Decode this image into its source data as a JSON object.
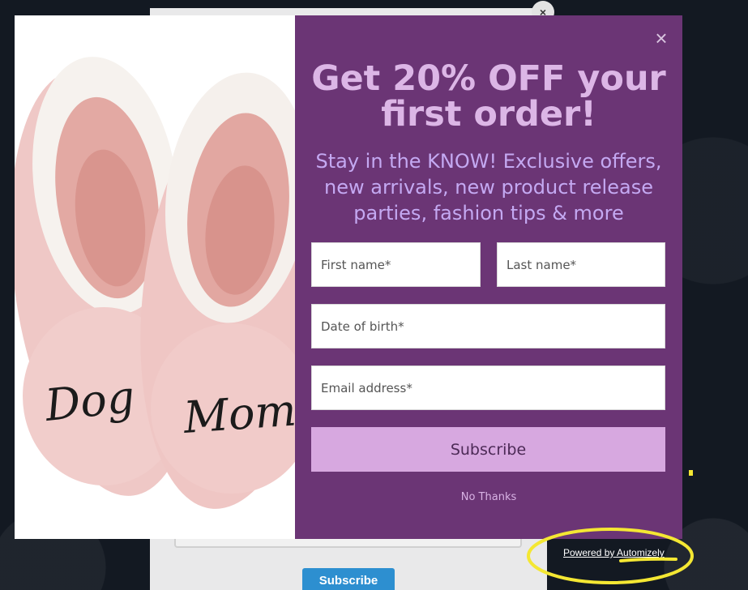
{
  "background": {
    "under_modal_close": "×",
    "under_modal_subscribe_label": "Subscribe"
  },
  "popup": {
    "image_text": {
      "left_slipper": "Dog",
      "right_slipper": "Mom"
    },
    "close_glyph": "×",
    "headline": "Get 20% OFF your first order!",
    "subheadline": "Stay in the KNOW! Exclusive offers, new arrivals, new product release parties, fashion tips & more",
    "fields": {
      "first_name_placeholder": "First name*",
      "last_name_placeholder": "Last name*",
      "dob_placeholder": "Date of birth*",
      "email_placeholder": "Email address*"
    },
    "subscribe_label": "Subscribe",
    "no_thanks_label": "No Thanks"
  },
  "footer": {
    "powered_by": "Powered by Automizely"
  },
  "colors": {
    "popup_bg": "#6b3575",
    "headline": "#dcb6e6",
    "subline": "#c4a9f2",
    "button": "#d7a8e0",
    "annotation": "#f4e733"
  },
  "icons": [
    "close-icon"
  ]
}
